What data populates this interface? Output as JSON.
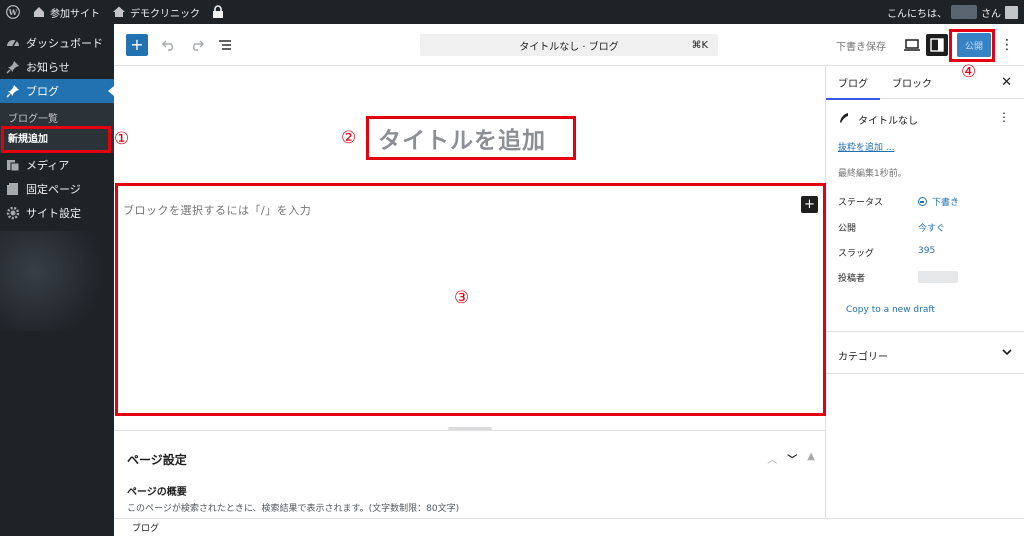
{
  "admin_bar": {
    "site_name": "参加サイト",
    "clinic_name": "デモクリニック",
    "greeting": "こんにちは、",
    "greeting_suffix": "さん"
  },
  "sidebar": {
    "items": [
      {
        "label": "ダッシュボード",
        "icon": "dashboard-icon"
      },
      {
        "label": "お知らせ",
        "icon": "pin-icon"
      },
      {
        "label": "ブログ",
        "icon": "pin-icon"
      },
      {
        "label": "メディア",
        "icon": "media-icon"
      },
      {
        "label": "固定ページ",
        "icon": "page-icon"
      },
      {
        "label": "サイト設定",
        "icon": "gear-icon"
      }
    ],
    "submenu": [
      "ブログ一覧",
      "新規追加"
    ]
  },
  "header": {
    "command_title": "タイトルなし · ブログ",
    "command_shortcut": "⌘K",
    "save_draft": "下書き保存",
    "publish": "公開"
  },
  "canvas": {
    "title_placeholder": "タイトルを追加",
    "block_placeholder": "ブロックを選択するには「/」を入力"
  },
  "metabox": {
    "title": "ページ設定",
    "subtitle": "ページの概要",
    "description": "このページが検索されたときに、検索結果で表示されます。(文字数制限：80文字)"
  },
  "footer": {
    "breadcrumb": "ブログ"
  },
  "settings_sidebar": {
    "tabs": [
      "ブログ",
      "ブロック"
    ],
    "post_title": "タイトルなし",
    "add_excerpt": "抜粋を追加 ...",
    "last_edited": "最終編集1秒前。",
    "rows": [
      {
        "label": "ステータス",
        "value": "下書き"
      },
      {
        "label": "公開",
        "value": "今すぐ"
      },
      {
        "label": "スラッグ",
        "value": "395"
      },
      {
        "label": "投稿者",
        "value": ""
      }
    ],
    "copy_draft": "Copy to a new draft",
    "category": "カテゴリー"
  },
  "annotations": {
    "n1": "①",
    "n2": "②",
    "n3": "③",
    "n4": "④",
    "color": "#e3000f"
  },
  "colors": {
    "admin_dark": "#1d2327",
    "wp_blue": "#2271b1",
    "publish_blue": "#3582c4"
  }
}
